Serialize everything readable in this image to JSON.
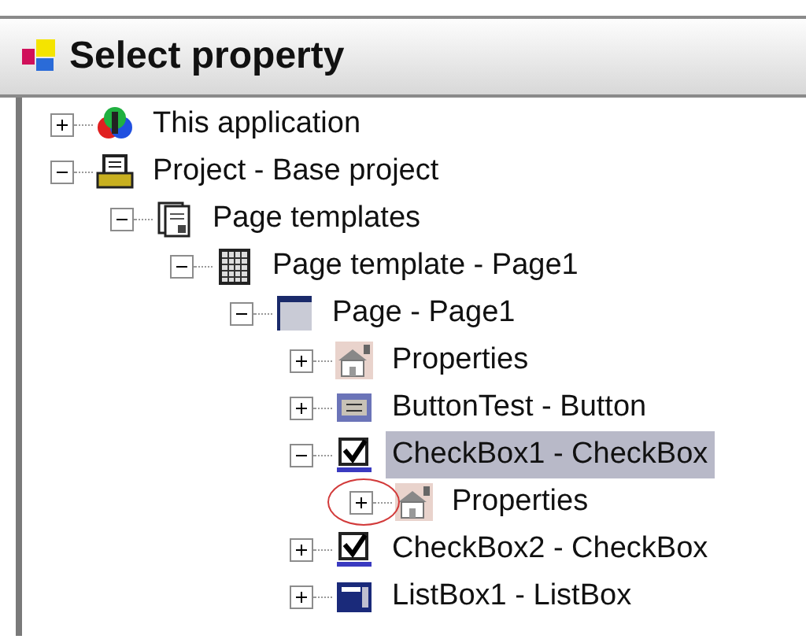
{
  "window": {
    "title": "Select property"
  },
  "tree": [
    {
      "label": "This application",
      "kind": "app",
      "expanded": false,
      "selected": false
    },
    {
      "label": "Project - Base project",
      "kind": "project",
      "expanded": true,
      "selected": false,
      "children": [
        {
          "label": "Page templates",
          "kind": "templates",
          "expanded": true,
          "selected": false,
          "children": [
            {
              "label": "Page template - Page1",
              "kind": "template",
              "expanded": true,
              "selected": false,
              "children": [
                {
                  "label": "Page - Page1",
                  "kind": "page",
                  "expanded": true,
                  "selected": false,
                  "children": [
                    {
                      "label": "Properties",
                      "kind": "properties",
                      "expanded": false,
                      "selected": false
                    },
                    {
                      "label": "ButtonTest - Button",
                      "kind": "button",
                      "expanded": false,
                      "selected": false
                    },
                    {
                      "label": "CheckBox1 - CheckBox",
                      "kind": "checkbox",
                      "expanded": true,
                      "selected": true,
                      "children": [
                        {
                          "label": "Properties",
                          "kind": "properties",
                          "expanded": false,
                          "selected": false,
                          "circled": true
                        }
                      ]
                    },
                    {
                      "label": "CheckBox2 - CheckBox",
                      "kind": "checkbox",
                      "expanded": false,
                      "selected": false
                    },
                    {
                      "label": "ListBox1 - ListBox",
                      "kind": "listbox",
                      "expanded": false,
                      "selected": false
                    }
                  ]
                }
              ]
            }
          ]
        }
      ]
    }
  ]
}
